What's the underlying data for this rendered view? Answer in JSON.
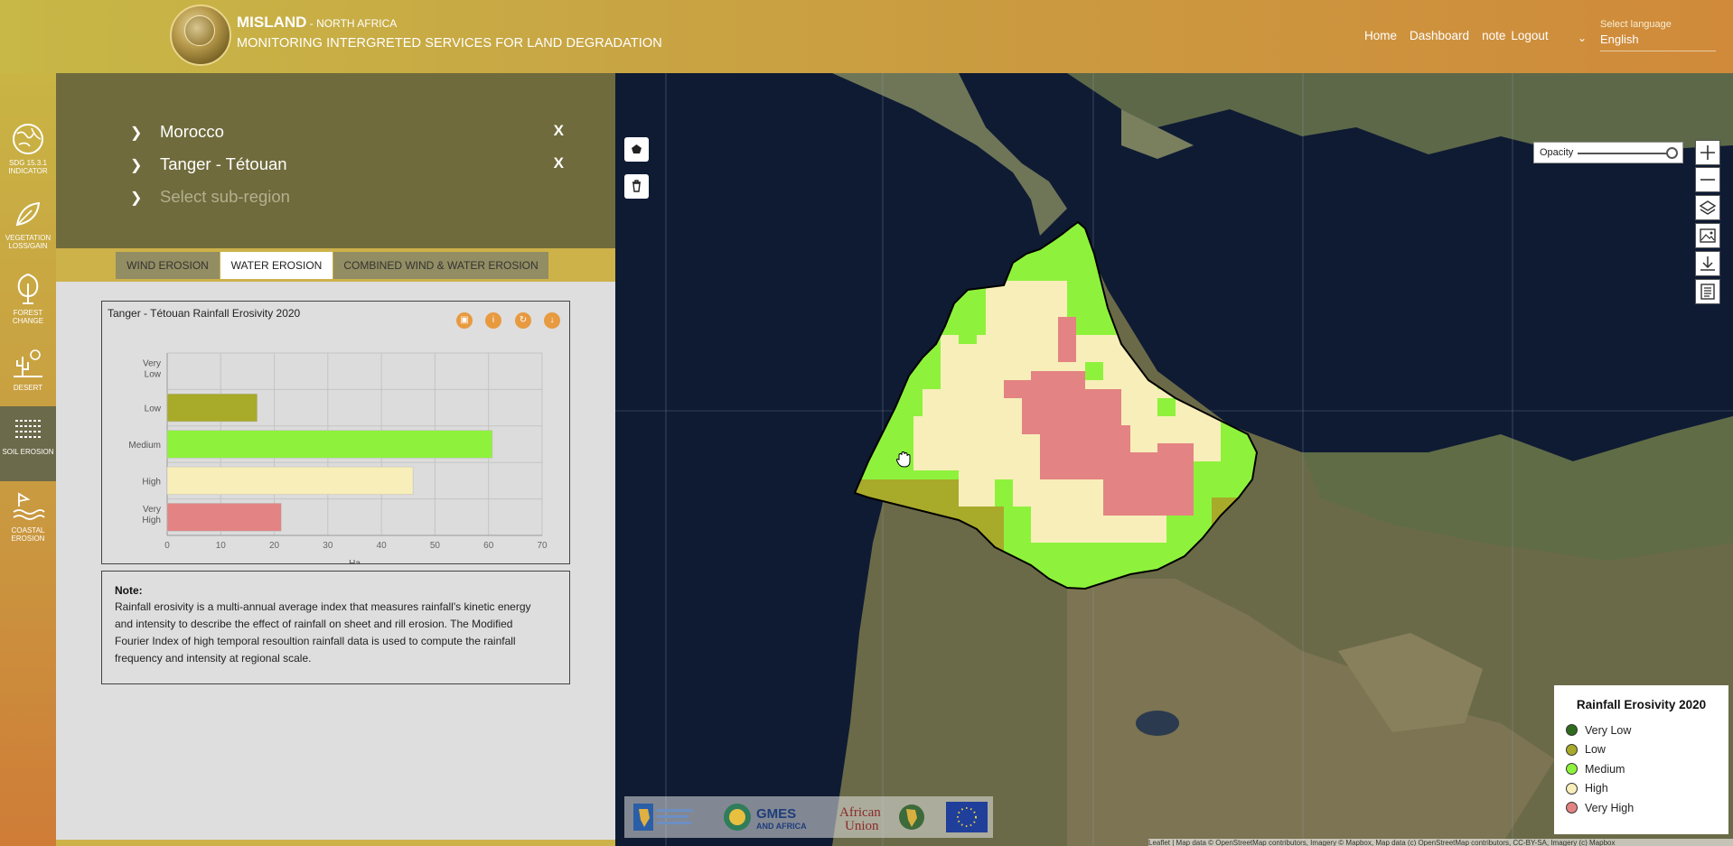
{
  "header": {
    "brand": "MISLAND",
    "brand_region": " - NORTH AFRICA",
    "subtitle": "MONITORING INTERGRETED SERVICES FOR LAND DEGRADATION",
    "nav": [
      "Home",
      "Dashboard",
      "note",
      "Logout"
    ],
    "language_label": "Select language",
    "language_value": "English"
  },
  "rail": [
    {
      "label": "SDG 15.3.1 INDICATOR",
      "icon": "globe-icon"
    },
    {
      "label": "VEGETATION LOSS/GAIN",
      "icon": "leaf-icon"
    },
    {
      "label": "FOREST CHANGE",
      "icon": "tree-icon"
    },
    {
      "label": "DESERT",
      "icon": "cactus-icon"
    },
    {
      "label": "SOIL EROSION",
      "icon": "soil-erosion-icon",
      "active": true
    },
    {
      "label": "COASTAL EROSION",
      "icon": "coastal-icon"
    }
  ],
  "selector": {
    "country": "Morocco",
    "region": "Tanger - Tétouan",
    "subregion_placeholder": "Select sub-region",
    "clear": "X"
  },
  "tabs": [
    {
      "label": "WIND EROSION",
      "active": false
    },
    {
      "label": "WATER EROSION",
      "active": true
    },
    {
      "label": "COMBINED WIND & WATER EROSION",
      "active": false
    }
  ],
  "chart_data": {
    "type": "bar",
    "orientation": "horizontal",
    "title": "Tanger - Tétouan Rainfall Erosivity 2020",
    "categories": [
      "Very Low",
      "Low",
      "Medium",
      "High",
      "Very High"
    ],
    "values": [
      0,
      16.8,
      60.7,
      45.9,
      21.3
    ],
    "colors": [
      "#2f6b1e",
      "#a8aa2a",
      "#8ef23c",
      "#f7eeb9",
      "#e48383"
    ],
    "xlabel": "Ha",
    "ylabel": "",
    "xlim": [
      0,
      70
    ],
    "xticks": [
      0,
      10,
      20,
      30,
      40,
      50,
      60,
      70
    ],
    "grid": true
  },
  "chart_buttons": [
    "image-icon",
    "info-icon",
    "refresh-icon",
    "download-icon"
  ],
  "note": {
    "title": "Note:",
    "lines": [
      "Rainfall erosivity is a multi-annual average index that measures rainfall's kinetic energy",
      "and intensity to describe the effect of rainfall on sheet and rill erosion. The Modified",
      "Fourier Index of high temporal resoultion rainfall data is used to compute the rainfall",
      "frequency and intensity at regional scale."
    ]
  },
  "map": {
    "opacity_label": "Opacity",
    "opacity_value": 1.0,
    "legend_title": "Rainfall Erosivity 2020",
    "legend": [
      {
        "label": "Very Low",
        "color": "#2f6b1e"
      },
      {
        "label": "Low",
        "color": "#a8aa2a"
      },
      {
        "label": "Medium",
        "color": "#8ef23c"
      },
      {
        "label": "High",
        "color": "#f7eeb9"
      },
      {
        "label": "Very High",
        "color": "#e48383"
      }
    ],
    "partners": [
      "GMES AND AFRICA",
      "African Union"
    ],
    "attribution": "Leaflet | Map data © OpenStreetMap contributors, Imagery © Mapbox, Map data (c) OpenStreetMap contributors, CC-BY-SA, Imagery (c) Mapbox"
  }
}
